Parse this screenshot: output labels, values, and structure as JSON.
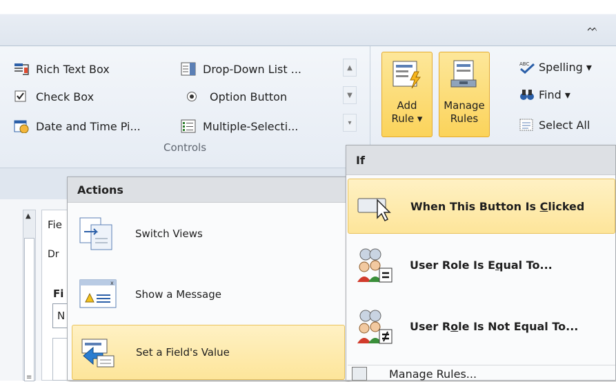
{
  "ribbon": {
    "collapse_glyph": "ᨓ",
    "controls": {
      "rich_text_box": "Rich Text Box",
      "check_box": "Check Box",
      "date_time_picker": "Date and Time Pi...",
      "dropdown_list": "Drop-Down List ...",
      "option_button": "Option Button",
      "multiple_selection": "Multiple-Selecti...",
      "group_label": "Controls"
    },
    "rules": {
      "add_rule_line1": "Add",
      "add_rule_line2": "Rule ▾",
      "manage_rules_line1": "Manage",
      "manage_rules_line2": "Rules"
    },
    "editing": {
      "spelling": "Spelling ▾",
      "find": "Find ▾",
      "select_all": "Select All"
    }
  },
  "pane": {
    "tab_fragment": "Fie",
    "line1": "Dr",
    "line2": "Fi",
    "input_value": "N"
  },
  "actions_menu": {
    "header": "Actions",
    "items": [
      {
        "label": "Switch Views",
        "icon": "switch-views-icon"
      },
      {
        "label": "Show a Message",
        "icon": "show-message-icon"
      },
      {
        "label": "Set a Field's Value",
        "icon": "set-field-value-icon"
      }
    ]
  },
  "rule_menu": {
    "header": "If",
    "items": [
      {
        "pre": "When This Button Is ",
        "key": "C",
        "post": "licked"
      },
      {
        "pre": "User Role Is E",
        "key": "q",
        "post": "ual To..."
      },
      {
        "pre": "User R",
        "key": "o",
        "post": "le Is Not Equal To..."
      }
    ],
    "manage": "Manage Rules..."
  },
  "colors": {
    "hover_fill": "#fde59a",
    "hover_border": "#e9c25b",
    "ribbon_bg": "#e6ecf4"
  }
}
